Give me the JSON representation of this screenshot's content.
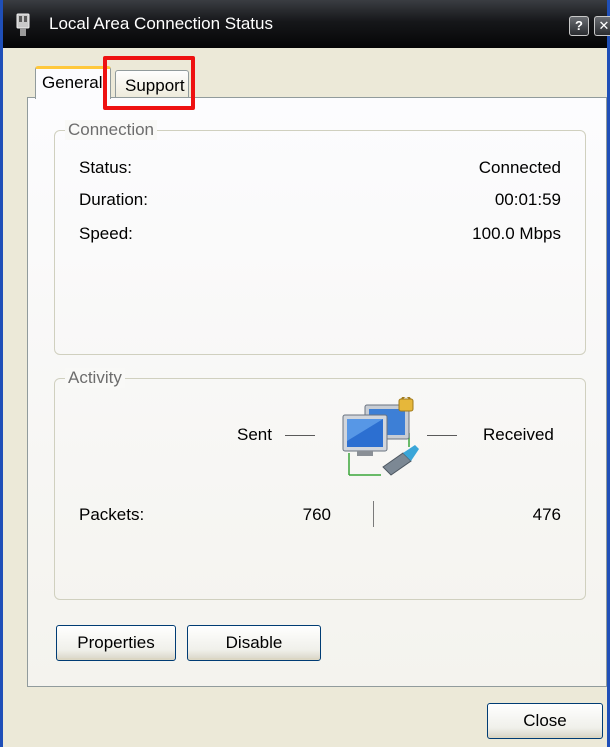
{
  "window": {
    "title": "Local Area Connection Status",
    "help_button": "?",
    "close_button": "✕"
  },
  "tabs": [
    {
      "label": "General",
      "active": true
    },
    {
      "label": "Support",
      "active": false
    }
  ],
  "connection": {
    "group_label": "Connection",
    "rows": [
      {
        "label": "Status:",
        "value": "Connected"
      },
      {
        "label": "Duration:",
        "value": "00:01:59"
      },
      {
        "label": "Speed:",
        "value": "100.0 Mbps"
      }
    ]
  },
  "activity": {
    "group_label": "Activity",
    "sent_label": "Sent",
    "received_label": "Received",
    "packets_label": "Packets:",
    "packets_sent": "760",
    "packets_received": "476"
  },
  "buttons": {
    "properties": "Properties",
    "disable": "Disable",
    "close": "Close"
  },
  "colors": {
    "highlight": "#ee1111",
    "window_border": "#1f4fb8",
    "active_tab_accent": "#ffc83c"
  },
  "icons": {
    "title": "network-adapter-icon",
    "activity": "network-computers-icon"
  }
}
